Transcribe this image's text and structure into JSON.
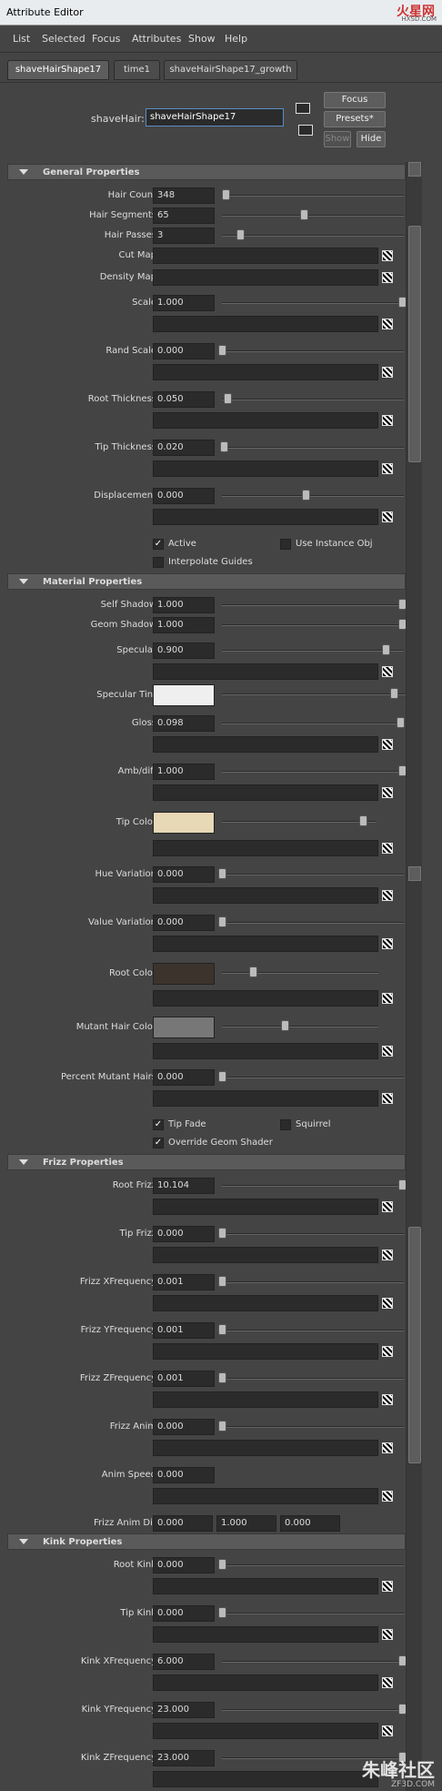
{
  "window": {
    "title": "Attribute Editor",
    "watermark_top": "火星网",
    "watermark_top_sub": "HXSD.COM"
  },
  "menus": [
    "List",
    "Selected",
    "Focus",
    "Attributes",
    "Show",
    "Help"
  ],
  "tabs": [
    "shaveHairShape17",
    "time1",
    "shaveHairShape17_growth"
  ],
  "header": {
    "node_label": "shaveHair:",
    "node_value": "shaveHairShape17",
    "focus": "Focus",
    "presets": "Presets*",
    "show": "Show",
    "hide": "Hide"
  },
  "general": {
    "title": "General Properties",
    "hair_count": {
      "label": "Hair Count",
      "value": "348",
      "slider": 0.02
    },
    "hair_segments": {
      "label": "Hair Segments",
      "value": "65",
      "slider": 0.45
    },
    "hair_passes": {
      "label": "Hair Passes",
      "value": "3",
      "slider": 0.1
    },
    "cut_map": "Cut Map",
    "density_map": "Density Map",
    "scale": {
      "label": "Scale",
      "value": "1.000",
      "slider": 0.99
    },
    "rand_scale": {
      "label": "Rand Scale",
      "value": "0.000",
      "slider": 0.0
    },
    "root_thickness": {
      "label": "Root Thickness",
      "value": "0.050",
      "slider": 0.03
    },
    "tip_thickness": {
      "label": "Tip Thickness",
      "value": "0.020",
      "slider": 0.01
    },
    "displacement": {
      "label": "Displacement",
      "value": "0.000",
      "slider": 0.46
    },
    "active": "Active",
    "use_instance": "Use Instance Obj",
    "interp": "Interpolate Guides"
  },
  "material": {
    "title": "Material Properties",
    "self_shadow": {
      "label": "Self Shadow",
      "value": "1.000",
      "slider": 0.99
    },
    "geom_shadow": {
      "label": "Geom Shadow",
      "value": "1.000",
      "slider": 0.99
    },
    "specular": {
      "label": "Specular",
      "value": "0.900",
      "slider": 0.9
    },
    "specular_tint": {
      "label": "Specular Tint",
      "color": "#efefef",
      "slider": 0.91
    },
    "gloss": {
      "label": "Gloss",
      "value": "0.098",
      "slider": 0.98
    },
    "amb_diff": {
      "label": "Amb/diff",
      "value": "1.000",
      "slider": 0.99
    },
    "tip_color": {
      "label": "Tip Color",
      "color": "#e7d8b6",
      "slider": 0.91
    },
    "hue_variation": {
      "label": "Hue Variation",
      "value": "0.000",
      "slider": 0.0
    },
    "value_variation": {
      "label": "Value Variation",
      "value": "0.000",
      "slider": 0.0
    },
    "root_color": {
      "label": "Root Color",
      "color": "#3b332c",
      "slider": 0.2
    },
    "mutant_color": {
      "label": "Mutant Hair Color",
      "color": "#777777",
      "slider": 0.4
    },
    "percent_mutant": {
      "label": "Percent Mutant Hairs",
      "value": "0.000",
      "slider": 0.0
    },
    "tip_fade": "Tip Fade",
    "squirrel": "Squirrel",
    "override": "Override Geom Shader"
  },
  "frizz": {
    "title": "Frizz Properties",
    "root_frizz": {
      "label": "Root Frizz",
      "value": "10.104",
      "slider": 0.99
    },
    "tip_frizz": {
      "label": "Tip Frizz",
      "value": "0.000",
      "slider": 0.0
    },
    "xfreq": {
      "label": "Frizz XFrequency",
      "value": "0.001",
      "slider": 0.0
    },
    "yfreq": {
      "label": "Frizz YFrequency",
      "value": "0.001",
      "slider": 0.0
    },
    "zfreq": {
      "label": "Frizz ZFrequency",
      "value": "0.001",
      "slider": 0.0
    },
    "anim": {
      "label": "Frizz Anim",
      "value": "0.000",
      "slider": 0.0
    },
    "anim_speed": {
      "label": "Anim Speed",
      "value": "0.000"
    },
    "anim_dir": {
      "label": "Frizz Anim Dir",
      "x": "0.000",
      "y": "1.000",
      "z": "0.000"
    }
  },
  "kink": {
    "title": "Kink Properties",
    "root_kink": {
      "label": "Root Kink",
      "value": "0.000",
      "slider": 0.0
    },
    "tip_kink": {
      "label": "Tip Kink",
      "value": "0.000",
      "slider": 0.0
    },
    "xfreq": {
      "label": "Kink XFrequency",
      "value": "6.000",
      "slider": 0.99
    },
    "yfreq": {
      "label": "Kink YFrequency",
      "value": "23.000",
      "slider": 0.99
    },
    "zfreq": {
      "label": "Kink ZFrequency",
      "value": "23.000",
      "slider": 0.99
    }
  },
  "footer_watermark": {
    "text": "朱峰社区",
    "sub": "ZF3D.COM"
  }
}
